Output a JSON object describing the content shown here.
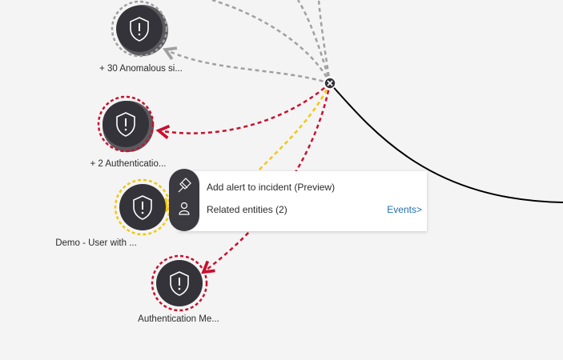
{
  "nodes": [
    {
      "label": "+ 30 Anomalous si...",
      "status_color": "#a0a0a0",
      "stacked": true
    },
    {
      "label": "+ 2 Authenticatio...",
      "status_color": "#c8102e",
      "stacked": true
    },
    {
      "label": "Demo - User with ...",
      "status_color": "#f2c811",
      "stacked": false
    },
    {
      "label": "Authentication Me...",
      "status_color": "#c8102e",
      "stacked": false
    }
  ],
  "context_menu": {
    "add_alert_label": "Add alert to incident (Preview)",
    "related_entities_label": "Related entities (2)",
    "events_link": "Events>"
  },
  "colors": {
    "node_fill": "#34333a",
    "edge_gray": "#a0a0a0",
    "edge_red": "#c8102e",
    "edge_yellow": "#f2c811",
    "link_blue": "#1f6fb2"
  }
}
